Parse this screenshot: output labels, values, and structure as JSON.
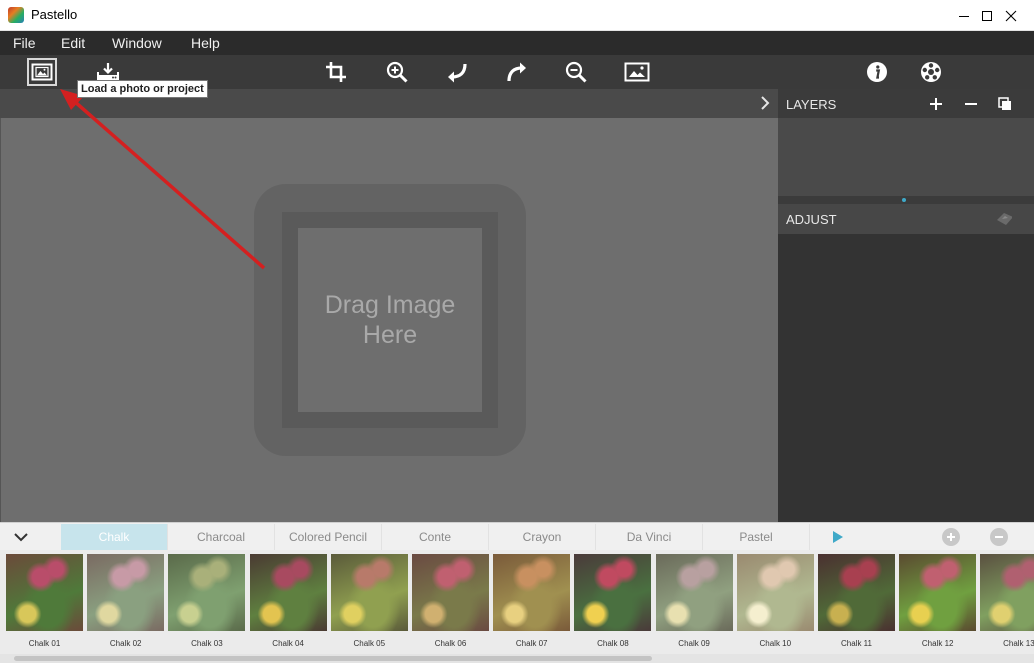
{
  "window": {
    "title": "Pastello"
  },
  "menu": {
    "items": [
      "File",
      "Edit",
      "Window",
      "Help"
    ]
  },
  "toolbar": {
    "tooltip": "Load a photo or project",
    "buttons": [
      "load-photo-icon",
      "save-project-icon",
      "crop-icon",
      "zoom-in-icon",
      "undo-icon",
      "redo-icon",
      "zoom-out-icon",
      "fit-image-icon",
      "info-icon",
      "settings-icon"
    ]
  },
  "canvas": {
    "drop_line1": "Drag Image",
    "drop_line2": "Here"
  },
  "panels": {
    "layers_title": "LAYERS",
    "adjust_title": "ADJUST"
  },
  "styles": {
    "tabs": [
      "Chalk",
      "Charcoal",
      "Colored Pencil",
      "Conte",
      "Crayon",
      "Da Vinci",
      "Pastel"
    ],
    "active_tab": "Chalk",
    "thumbnails": [
      "Chalk 01",
      "Chalk 02",
      "Chalk 03",
      "Chalk 04",
      "Chalk 05",
      "Chalk 06",
      "Chalk 07",
      "Chalk 08",
      "Chalk 09",
      "Chalk 10",
      "Chalk 11",
      "Chalk 12",
      "Chalk 13"
    ]
  },
  "colors": {
    "accent": "#3fa9c8",
    "active_tab_bg": "#c7e4ec",
    "annotation_arrow": "#d42020"
  }
}
